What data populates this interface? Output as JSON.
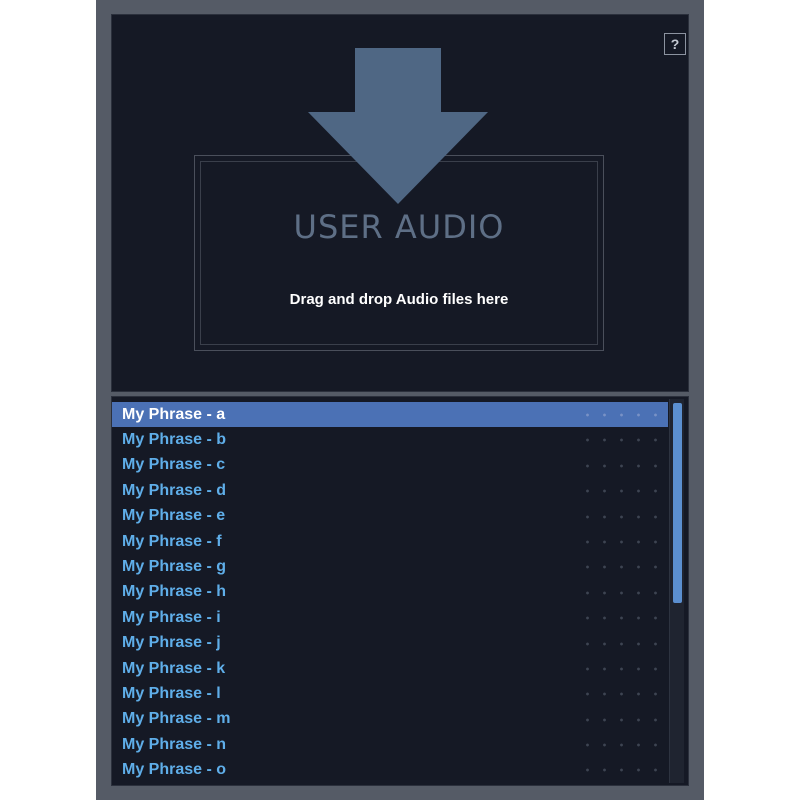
{
  "help": {
    "label": "?"
  },
  "drop_zone": {
    "title": "USER AUDIO",
    "hint": "Drag and drop Audio files here",
    "icon": "arrow-down-icon"
  },
  "phrase_list": {
    "selected_index": 0,
    "items": [
      {
        "label": "My Phrase - a"
      },
      {
        "label": "My Phrase - b"
      },
      {
        "label": "My Phrase - c"
      },
      {
        "label": "My Phrase - d"
      },
      {
        "label": "My Phrase - e"
      },
      {
        "label": "My Phrase - f"
      },
      {
        "label": "My Phrase - g"
      },
      {
        "label": "My Phrase - h"
      },
      {
        "label": "My Phrase - i"
      },
      {
        "label": "My Phrase - j"
      },
      {
        "label": "My Phrase - k"
      },
      {
        "label": "My Phrase - l"
      },
      {
        "label": "My Phrase - m"
      },
      {
        "label": "My Phrase - n"
      },
      {
        "label": "My Phrase - o"
      }
    ]
  },
  "colors": {
    "background": "#151925",
    "frame": "#555b66",
    "selection": "#4b71b5",
    "item_text": "#5faee9",
    "arrow": "#4f6784",
    "scrollbar_thumb": "#5b8fd0"
  }
}
